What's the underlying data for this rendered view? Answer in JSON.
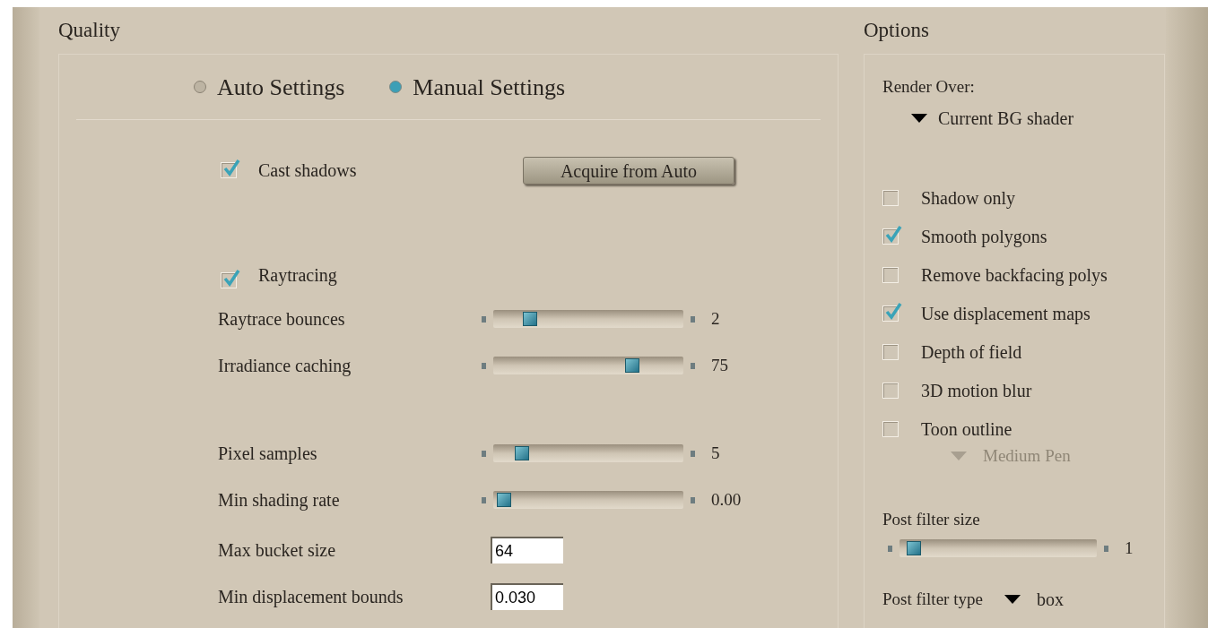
{
  "quality": {
    "title": "Quality",
    "modes": [
      {
        "label": "Auto Settings",
        "selected": false
      },
      {
        "label": "Manual Settings",
        "selected": true
      }
    ],
    "cast_shadows": {
      "label": "Cast shadows",
      "checked": true
    },
    "acquire_button": "Acquire from Auto",
    "raytracing": {
      "label": "Raytracing",
      "checked": true
    },
    "sliders_a": [
      {
        "label": "Raytrace bounces",
        "level": 0.17,
        "reading": "2"
      },
      {
        "label": "Irradiance caching",
        "level": 0.75,
        "reading": "75"
      }
    ],
    "sliders_b": [
      {
        "label": "Pixel samples",
        "level": 0.12,
        "reading": "5"
      },
      {
        "label": "Min shading rate",
        "level": 0.02,
        "reading": "0.00"
      }
    ],
    "fields": [
      {
        "label": "Max bucket size",
        "value": "64"
      },
      {
        "label": "Min displacement bounds",
        "value": "0.030"
      }
    ]
  },
  "options": {
    "title": "Options",
    "render_over": {
      "label": "Render Over:",
      "value": "Current BG shader"
    },
    "checkboxes": [
      {
        "label": "Shadow only",
        "checked": false
      },
      {
        "label": "Smooth polygons",
        "checked": true
      },
      {
        "label": "Remove backfacing polys",
        "checked": false
      },
      {
        "label": "Use displacement maps",
        "checked": true
      },
      {
        "label": "Depth of field",
        "checked": false
      },
      {
        "label": "3D motion blur",
        "checked": false
      },
      {
        "label": "Toon outline",
        "checked": false
      }
    ],
    "pen": {
      "value": "Medium Pen",
      "disabled": true
    },
    "post_filter_size": {
      "label": "Post filter size",
      "level": 0.04,
      "reading": "1"
    },
    "post_filter_type": {
      "label": "Post filter type",
      "value": "box"
    }
  }
}
